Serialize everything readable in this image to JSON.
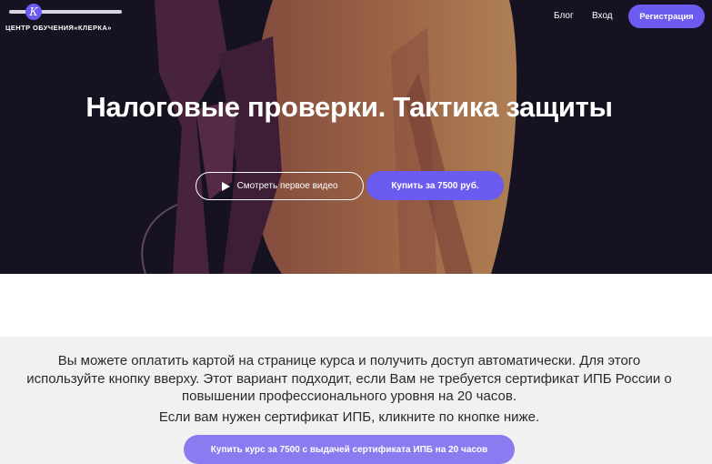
{
  "logo": {
    "text": "ЦЕНТР ОБУЧЕНИЯ«КЛЕРКА»",
    "mark": "К"
  },
  "nav": {
    "blog": "Блог",
    "login": "Вход",
    "register": "Регистрация"
  },
  "hero": {
    "title": "Налоговые проверки. Тактика защиты",
    "video_button": "Смотреть первое видео",
    "buy_button": "Купить за 7500 руб."
  },
  "info": {
    "text_line1": "Вы можете оплатить картой на странице курса и получить доступ автоматически. Для этого",
    "text_line2": "используйте кнопку вверху. Этот вариант подходит, если Вам не требуется сертификат ИПБ России о",
    "text_line3": "повышении профессионального уровня на 20 часов.",
    "text_cert": "Если вам нужен сертификат ИПБ, кликните по кнопке ниже.",
    "cert_button": "Купить курс за 7500 с выдачей сертификата ИПБ на 20 часов"
  },
  "colors": {
    "accent": "#6b5bf0",
    "hero_bg": "#1a1524",
    "info_bg": "#f2f1f1"
  }
}
